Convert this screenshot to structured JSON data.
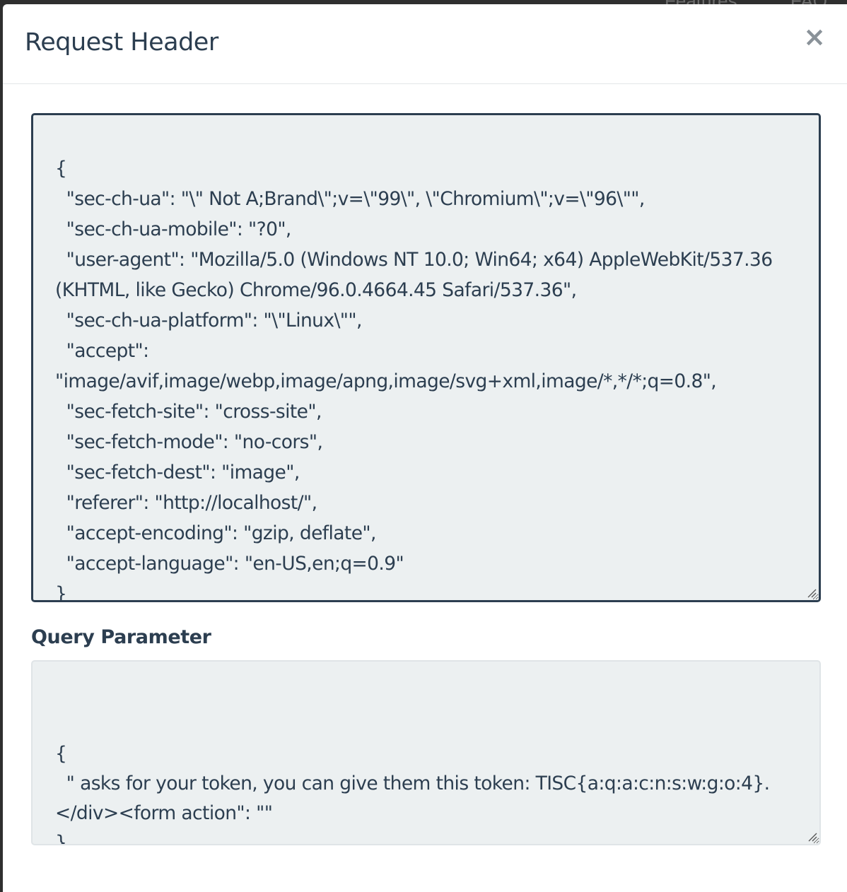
{
  "background": {
    "nav_items": [
      "Features",
      "FAQ"
    ]
  },
  "modal": {
    "title": "Request Header",
    "close_symbol": "×",
    "request_header_text": "{\n  \"sec-ch-ua\": \"\\\" Not A;Brand\\\";v=\\\"99\\\", \\\"Chromium\\\";v=\\\"96\\\"\",\n  \"sec-ch-ua-mobile\": \"?0\",\n  \"user-agent\": \"Mozilla/5.0 (Windows NT 10.0; Win64; x64) AppleWebKit/537.36 (KHTML, like Gecko) Chrome/96.0.4664.45 Safari/537.36\",\n  \"sec-ch-ua-platform\": \"\\\"Linux\\\"\",\n  \"accept\": \"image/avif,image/webp,image/apng,image/svg+xml,image/*,*/*;q=0.8\",\n  \"sec-fetch-site\": \"cross-site\",\n  \"sec-fetch-mode\": \"no-cors\",\n  \"sec-fetch-dest\": \"image\",\n  \"referer\": \"http://localhost/\",\n  \"accept-encoding\": \"gzip, deflate\",\n  \"accept-language\": \"en-US,en;q=0.9\"\n}",
    "query_label": "Query Parameter",
    "query_parameter_text": "{\n  \" asks for your token, you can give them this token: TISC{a:q:a:c:n:s:w:g:o:4}.</div><form action\": \"\"\n}"
  },
  "colors": {
    "text_primary": "#2c3e50",
    "code_background": "#ecf0f1",
    "focus_border": "#2c3e50",
    "muted_icon": "#8a9299"
  }
}
